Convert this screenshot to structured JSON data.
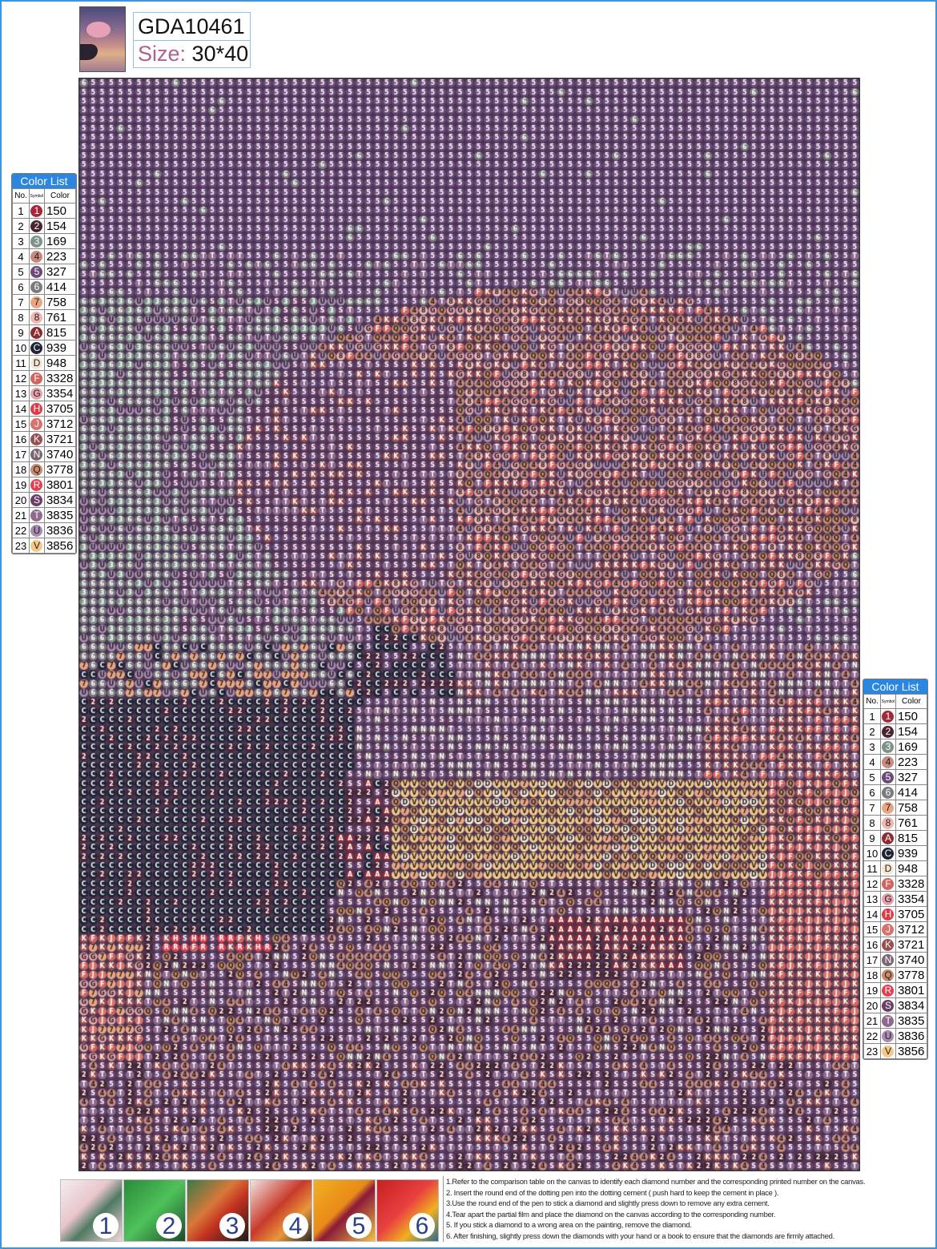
{
  "header": {
    "product_code": "GDA10461",
    "size_label": "Size:",
    "size_value": "30*40"
  },
  "color_list": {
    "title": "Color List",
    "headers": {
      "no": "No.",
      "symbol": "Symbol",
      "color": "Color"
    },
    "items": [
      {
        "no": "1",
        "symbol": "1",
        "color": "150",
        "hex": "#a3283a"
      },
      {
        "no": "2",
        "symbol": "2",
        "color": "154",
        "hex": "#4a2330"
      },
      {
        "no": "3",
        "symbol": "3",
        "color": "169",
        "hex": "#7f9288"
      },
      {
        "no": "4",
        "symbol": "4",
        "color": "223",
        "hex": "#c88a80"
      },
      {
        "no": "5",
        "symbol": "5",
        "color": "327",
        "hex": "#6b4a78"
      },
      {
        "no": "6",
        "symbol": "6",
        "color": "414",
        "hex": "#7b7b7f"
      },
      {
        "no": "7",
        "symbol": "7",
        "color": "758",
        "hex": "#e8a682"
      },
      {
        "no": "8",
        "symbol": "8",
        "color": "761",
        "hex": "#f0b6b0"
      },
      {
        "no": "9",
        "symbol": "A",
        "color": "815",
        "hex": "#8e2a32"
      },
      {
        "no": "10",
        "symbol": "C",
        "color": "939",
        "hex": "#1e2433"
      },
      {
        "no": "11",
        "symbol": "D",
        "color": "948",
        "hex": "#f7e6d3"
      },
      {
        "no": "12",
        "symbol": "F",
        "color": "3328",
        "hex": "#d0645e"
      },
      {
        "no": "13",
        "symbol": "G",
        "color": "3354",
        "hex": "#e4a3ab"
      },
      {
        "no": "14",
        "symbol": "H",
        "color": "3705",
        "hex": "#e03a45"
      },
      {
        "no": "15",
        "symbol": "J",
        "color": "3712",
        "hex": "#d8726a"
      },
      {
        "no": "16",
        "symbol": "K",
        "color": "3721",
        "hex": "#9a5050"
      },
      {
        "no": "17",
        "symbol": "N",
        "color": "3740",
        "hex": "#7a6670"
      },
      {
        "no": "18",
        "symbol": "Q",
        "color": "3778",
        "hex": "#c98a6c"
      },
      {
        "no": "19",
        "symbol": "R",
        "color": "3801",
        "hex": "#e43f4e"
      },
      {
        "no": "20",
        "symbol": "S",
        "color": "3834",
        "hex": "#6a3f66"
      },
      {
        "no": "21",
        "symbol": "T",
        "color": "3835",
        "hex": "#8f6a8e"
      },
      {
        "no": "22",
        "symbol": "U",
        "color": "3836",
        "hex": "#a98ab0"
      },
      {
        "no": "23",
        "symbol": "V",
        "color": "3856",
        "hex": "#f3c888"
      }
    ]
  },
  "steps": {
    "images": [
      {
        "number": "1"
      },
      {
        "number": "2"
      },
      {
        "number": "3"
      },
      {
        "number": "4"
      },
      {
        "number": "5"
      },
      {
        "number": "6"
      }
    ],
    "instructions": [
      "1.Refer to the comparison table on the canvas to identify each diamond number and the corresponding printed number on the canvas.",
      "2. Insert the round end of the dotting pen into the dotting cement ( push hard to keep the cement in place ).",
      "3.Use the round end of the pen to stick a diamond and slightly press down to remove any extra cement.",
      "4.Tear apart the partial film and place the diamond on the canvas according to the corresponding number.",
      "5. If you stick a diamond to a wrong area on the painting,   remove the diamond.",
      "6. After finishing, slightly press down the diamonds with your hand or a book to ensure that the diamonds are firmly attached."
    ]
  },
  "colors": {
    "frame": "#3f95db",
    "list_header": "#2a86df"
  }
}
